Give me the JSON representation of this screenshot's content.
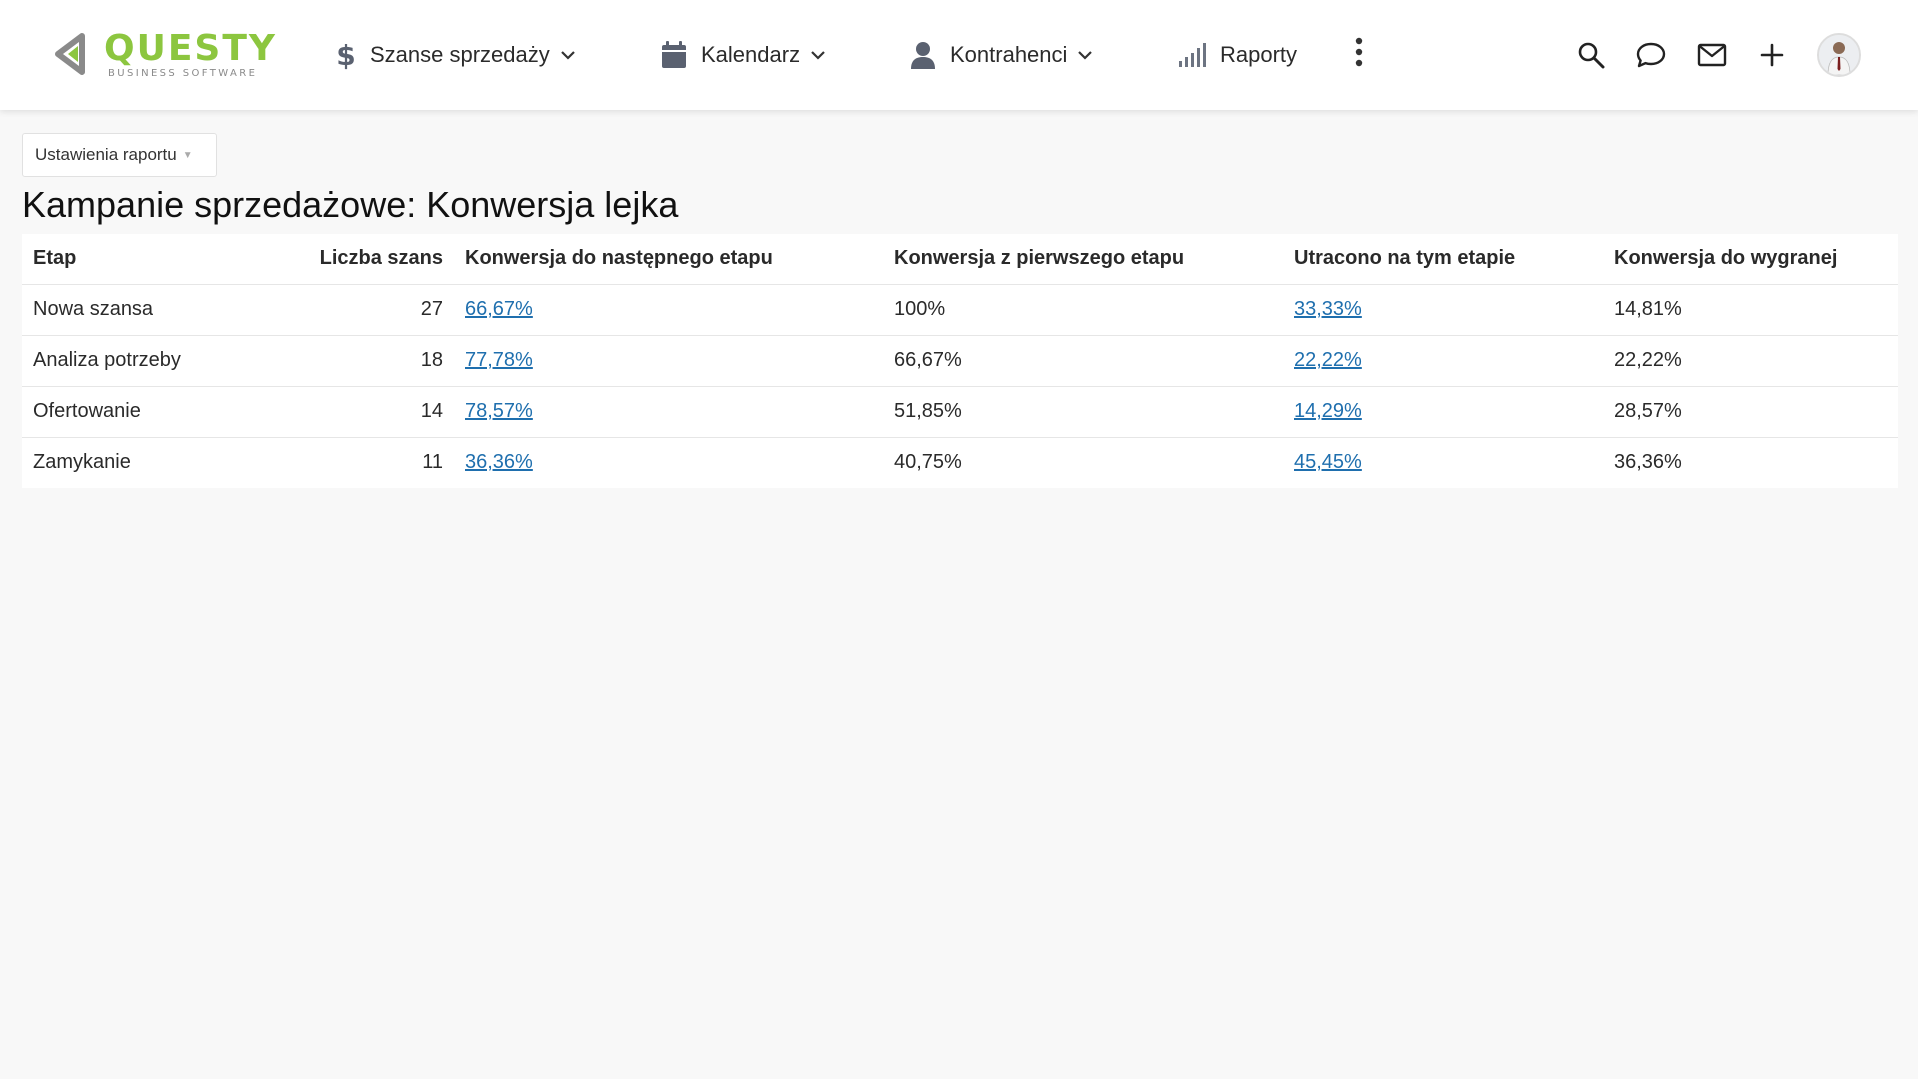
{
  "logo": {
    "word": "QUESTY",
    "tagline": "BUSINESS SOFTWARE",
    "color": "#8cc63f",
    "icon": "questy-logo-icon"
  },
  "nav": {
    "sales": {
      "label": "Szanse sprzedaży",
      "icon": "dollar-icon"
    },
    "calendar": {
      "label": "Kalendarz",
      "icon": "calendar-icon"
    },
    "contractors": {
      "label": "Kontrahenci",
      "icon": "person-icon"
    },
    "reports": {
      "label": "Raporty",
      "icon": "signal-bars-icon"
    },
    "more": {
      "icon": "more-vertical-icon"
    }
  },
  "toolbar_icons": [
    "search-icon",
    "chat-icon",
    "mail-icon",
    "plus-icon",
    "avatar"
  ],
  "settings_button": {
    "label": "Ustawienia raportu"
  },
  "page_title": "Kampanie sprzedażowe: Konwersja lejka",
  "table": {
    "headers": [
      "Etap",
      "Liczba szans",
      "Konwersja do następnego etapu",
      "Konwersja z pierwszego etapu",
      "Utracono na tym etapie",
      "Konwersja do wygranej"
    ],
    "rows": [
      {
        "stage": "Nowa szansa",
        "count": "27",
        "next": "66,67%",
        "first": "100%",
        "lost": "33,33%",
        "won": "14,81%"
      },
      {
        "stage": "Analiza potrzeby",
        "count": "18",
        "next": "77,78%",
        "first": "66,67%",
        "lost": "22,22%",
        "won": "22,22%"
      },
      {
        "stage": "Ofertowanie",
        "count": "14",
        "next": "78,57%",
        "first": "51,85%",
        "lost": "14,29%",
        "won": "28,57%"
      },
      {
        "stage": "Zamykanie",
        "count": "11",
        "next": "36,36%",
        "first": "40,75%",
        "lost": "45,45%",
        "won": "36,36%"
      }
    ]
  },
  "colors": {
    "link": "#1f6fae",
    "background": "#f8f8f8",
    "icon": "#5a6170"
  }
}
